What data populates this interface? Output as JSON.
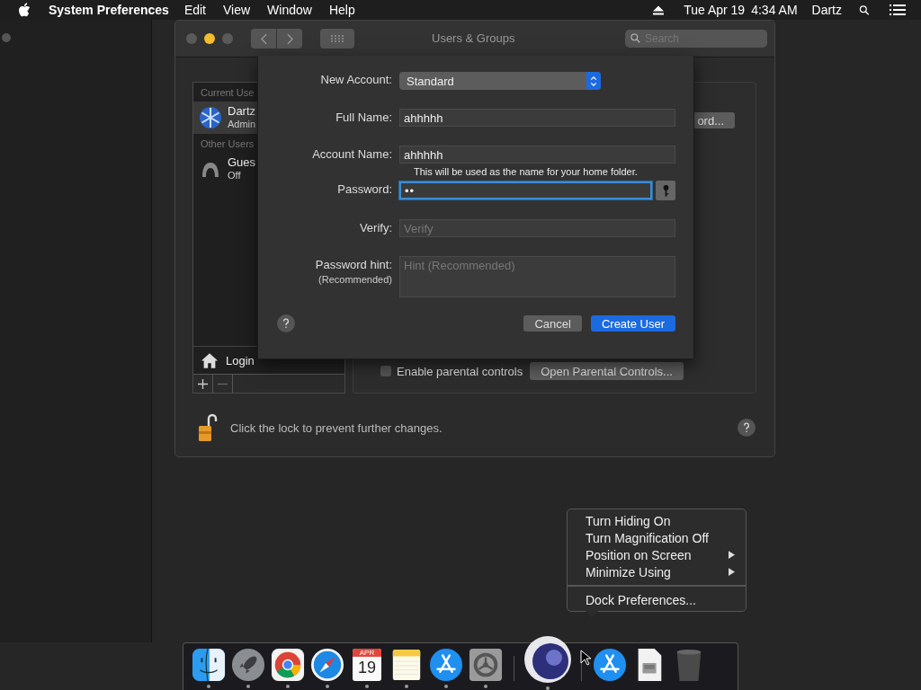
{
  "menu_bar": {
    "app": "System Preferences",
    "menus": [
      "Edit",
      "View",
      "Window",
      "Help"
    ],
    "date": "Tue Apr 19",
    "time": "4:34 AM",
    "user": "Dartz"
  },
  "window": {
    "title": "Users & Groups",
    "search": {
      "placeholder": "Search"
    },
    "sidebar": {
      "sections": [
        {
          "heading": "Current Use",
          "users": [
            {
              "name": "Dartz",
              "role": "Admin",
              "selected": true,
              "kind": "admin"
            }
          ]
        },
        {
          "heading": "Other Users",
          "users": [
            {
              "name": "Gues",
              "role": "Off",
              "selected": false,
              "kind": "guest"
            }
          ]
        }
      ],
      "login_options": "Login"
    },
    "password_button": "ord...",
    "parental": {
      "label": "Enable parental controls",
      "checked": false,
      "button": "Open Parental Controls..."
    },
    "lock_text": "Click the lock to prevent further changes."
  },
  "sheet": {
    "new_account": {
      "label": "New Account:",
      "value": "Standard"
    },
    "fields": [
      {
        "label": "Full Name:",
        "value": "ahhhhh",
        "kind": "text",
        "focused": false
      },
      {
        "label": "Account Name:",
        "value": "ahhhhh",
        "kind": "text",
        "note": "This will be used as the name for your home folder.",
        "focused": false
      },
      {
        "label": "Password:",
        "value": "••",
        "kind": "password",
        "focused": true
      },
      {
        "label": "Verify:",
        "placeholder": "Verify",
        "kind": "text",
        "focused": false
      },
      {
        "label": "Password hint:",
        "sublabel": "(Recommended)",
        "placeholder": "Hint (Recommended)",
        "kind": "textarea",
        "focused": false
      }
    ],
    "buttons": {
      "cancel": "Cancel",
      "create": "Create User"
    }
  },
  "dock_menu": {
    "groups": [
      [
        {
          "label": "Turn Hiding On",
          "submenu": false
        },
        {
          "label": "Turn Magnification Off",
          "submenu": false
        },
        {
          "label": "Position on Screen",
          "submenu": true
        },
        {
          "label": "Minimize Using",
          "submenu": true
        }
      ],
      [
        {
          "label": "Dock Preferences...",
          "submenu": false
        }
      ]
    ]
  },
  "dock": {
    "items": [
      {
        "kind": "finder",
        "running": true
      },
      {
        "kind": "launchpad",
        "running": true
      },
      {
        "kind": "chrome",
        "running": true
      },
      {
        "kind": "safari",
        "running": true
      },
      {
        "kind": "calendar",
        "running": true,
        "month": "APR",
        "day": "19"
      },
      {
        "kind": "notes",
        "running": true
      },
      {
        "kind": "appstore",
        "running": true
      },
      {
        "kind": "settings",
        "running": true
      },
      {
        "kind": "separator"
      },
      {
        "kind": "sphere",
        "running": true
      },
      {
        "kind": "separator"
      },
      {
        "kind": "appstore",
        "running": false
      },
      {
        "kind": "document",
        "running": false
      },
      {
        "kind": "trash",
        "running": false
      }
    ]
  }
}
